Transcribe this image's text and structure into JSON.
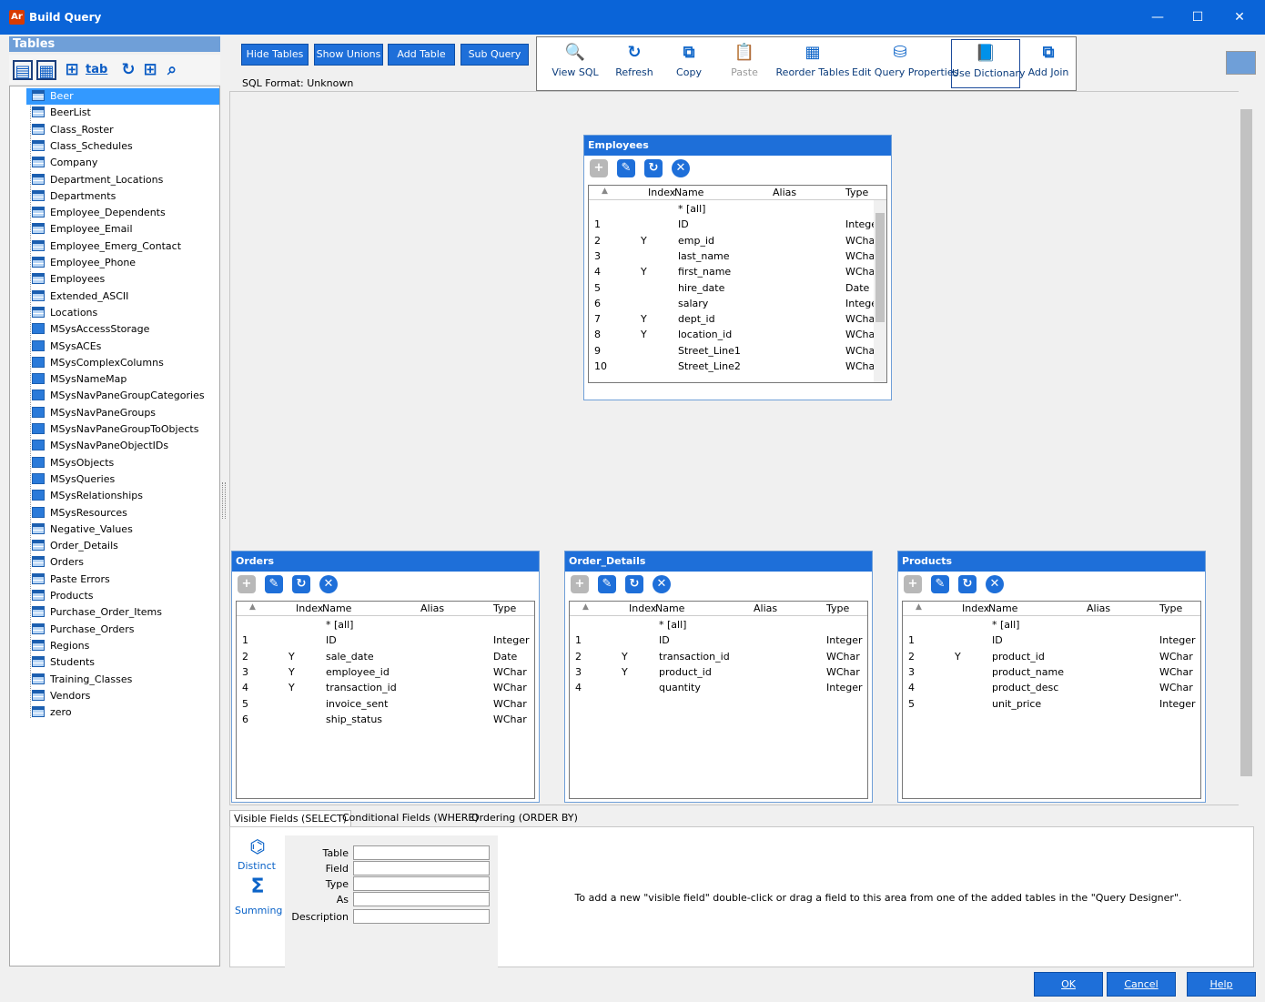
{
  "window": {
    "title": "Build Query",
    "logo": "Ar"
  },
  "left_panel": {
    "header": "Tables",
    "toolbar_icons": [
      "list-view-icon",
      "grid-view-icon",
      "table-icon",
      "tab-icon",
      "refresh-icon",
      "table-add-icon",
      "search-icon"
    ],
    "tab_label": "tab",
    "items": [
      {
        "label": "Beer",
        "type": "table",
        "selected": true
      },
      {
        "label": "BeerList",
        "type": "table"
      },
      {
        "label": "Class_Roster",
        "type": "table"
      },
      {
        "label": "Class_Schedules",
        "type": "table"
      },
      {
        "label": "Company",
        "type": "table"
      },
      {
        "label": "Department_Locations",
        "type": "table"
      },
      {
        "label": "Departments",
        "type": "table"
      },
      {
        "label": "Employee_Dependents",
        "type": "table"
      },
      {
        "label": "Employee_Email",
        "type": "table"
      },
      {
        "label": "Employee_Emerg_Contact",
        "type": "table"
      },
      {
        "label": "Employee_Phone",
        "type": "table"
      },
      {
        "label": "Employees",
        "type": "table"
      },
      {
        "label": "Extended_ASCII",
        "type": "table"
      },
      {
        "label": "Locations",
        "type": "table"
      },
      {
        "label": "MSysAccessStorage",
        "type": "system"
      },
      {
        "label": "MSysACEs",
        "type": "system"
      },
      {
        "label": "MSysComplexColumns",
        "type": "system"
      },
      {
        "label": "MSysNameMap",
        "type": "system"
      },
      {
        "label": "MSysNavPaneGroupCategories",
        "type": "system"
      },
      {
        "label": "MSysNavPaneGroups",
        "type": "system"
      },
      {
        "label": "MSysNavPaneGroupToObjects",
        "type": "system"
      },
      {
        "label": "MSysNavPaneObjectIDs",
        "type": "system"
      },
      {
        "label": "MSysObjects",
        "type": "system"
      },
      {
        "label": "MSysQueries",
        "type": "system"
      },
      {
        "label": "MSysRelationships",
        "type": "system"
      },
      {
        "label": "MSysResources",
        "type": "system"
      },
      {
        "label": "Negative_Values",
        "type": "table"
      },
      {
        "label": "Order_Details",
        "type": "table"
      },
      {
        "label": "Orders",
        "type": "table"
      },
      {
        "label": "Paste Errors",
        "type": "table"
      },
      {
        "label": "Products",
        "type": "table"
      },
      {
        "label": "Purchase_Order_Items",
        "type": "table"
      },
      {
        "label": "Purchase_Orders",
        "type": "table"
      },
      {
        "label": "Regions",
        "type": "table"
      },
      {
        "label": "Students",
        "type": "table"
      },
      {
        "label": "Training_Classes",
        "type": "table"
      },
      {
        "label": "Vendors",
        "type": "table"
      },
      {
        "label": "zero",
        "type": "table"
      }
    ]
  },
  "top_buttons": {
    "hide_tables": "Hide Tables",
    "show_unions": "Show Unions",
    "add_table": "Add Table",
    "sub_query": "Sub Query",
    "sql_format": "SQL Format: Unknown"
  },
  "toolbar": {
    "view_sql": "View SQL",
    "refresh": "Refresh",
    "copy": "Copy",
    "paste": "Paste",
    "reorder_tables": "Reorder Tables",
    "edit_query_properties": "Edit Query Properties",
    "use_dictionary": "Use Dictionary",
    "add_join": "Add Join"
  },
  "grid_headers": {
    "index": "Index",
    "name": "Name",
    "alias": "Alias",
    "type": "Type"
  },
  "designer_tables": {
    "employees": {
      "title": "Employees",
      "rows": [
        {
          "n": "",
          "idx": "",
          "name": "* [all]",
          "type": ""
        },
        {
          "n": "1",
          "idx": "",
          "name": "ID",
          "type": "Integer"
        },
        {
          "n": "2",
          "idx": "Y",
          "name": "emp_id",
          "type": "WChar"
        },
        {
          "n": "3",
          "idx": "",
          "name": "last_name",
          "type": "WChar"
        },
        {
          "n": "4",
          "idx": "Y",
          "name": "first_name",
          "type": "WChar"
        },
        {
          "n": "5",
          "idx": "",
          "name": "hire_date",
          "type": "Date"
        },
        {
          "n": "6",
          "idx": "",
          "name": "salary",
          "type": "Integer"
        },
        {
          "n": "7",
          "idx": "Y",
          "name": "dept_id",
          "type": "WChar"
        },
        {
          "n": "8",
          "idx": "Y",
          "name": "location_id",
          "type": "WChar"
        },
        {
          "n": "9",
          "idx": "",
          "name": "Street_Line1",
          "type": "WChar"
        },
        {
          "n": "10",
          "idx": "",
          "name": "Street_Line2",
          "type": "WChar"
        }
      ]
    },
    "orders": {
      "title": "Orders",
      "rows": [
        {
          "n": "",
          "idx": "",
          "name": "* [all]",
          "type": ""
        },
        {
          "n": "1",
          "idx": "",
          "name": "ID",
          "type": "Integer"
        },
        {
          "n": "2",
          "idx": "Y",
          "name": "sale_date",
          "type": "Date"
        },
        {
          "n": "3",
          "idx": "Y",
          "name": "employee_id",
          "type": "WChar"
        },
        {
          "n": "4",
          "idx": "Y",
          "name": "transaction_id",
          "type": "WChar"
        },
        {
          "n": "5",
          "idx": "",
          "name": "invoice_sent",
          "type": "WChar"
        },
        {
          "n": "6",
          "idx": "",
          "name": "ship_status",
          "type": "WChar"
        }
      ]
    },
    "order_details": {
      "title": "Order_Details",
      "rows": [
        {
          "n": "",
          "idx": "",
          "name": "* [all]",
          "type": ""
        },
        {
          "n": "1",
          "idx": "",
          "name": "ID",
          "type": "Integer"
        },
        {
          "n": "2",
          "idx": "Y",
          "name": "transaction_id",
          "type": "WChar"
        },
        {
          "n": "3",
          "idx": "Y",
          "name": "product_id",
          "type": "WChar"
        },
        {
          "n": "4",
          "idx": "",
          "name": "quantity",
          "type": "Integer"
        }
      ]
    },
    "products": {
      "title": "Products",
      "rows": [
        {
          "n": "",
          "idx": "",
          "name": "* [all]",
          "type": ""
        },
        {
          "n": "1",
          "idx": "",
          "name": "ID",
          "type": "Integer"
        },
        {
          "n": "2",
          "idx": "Y",
          "name": "product_id",
          "type": "WChar"
        },
        {
          "n": "3",
          "idx": "",
          "name": "product_name",
          "type": "WChar"
        },
        {
          "n": "4",
          "idx": "",
          "name": "product_desc",
          "type": "WChar"
        },
        {
          "n": "5",
          "idx": "",
          "name": "unit_price",
          "type": "Integer"
        }
      ]
    }
  },
  "bottom": {
    "tabs": [
      "Visible Fields (SELECT)",
      "Conditional Fields (WHERE)",
      "Ordering (ORDER BY)"
    ],
    "distinct": "Distinct",
    "summing": "Summing",
    "props": {
      "table": "Table",
      "field": "Field",
      "type": "Type",
      "as": "As",
      "description": "Description"
    },
    "hint": "To add a new \"visible field\" double-click or drag a field to this area from one of the added tables in the \"Query Designer\"."
  },
  "dialog_buttons": {
    "ok": "OK",
    "cancel": "Cancel",
    "help": "Help"
  },
  "colors": {
    "titlebar": "#0a64d8",
    "accent": "#1e6fd9",
    "selection": "#3399ff"
  }
}
